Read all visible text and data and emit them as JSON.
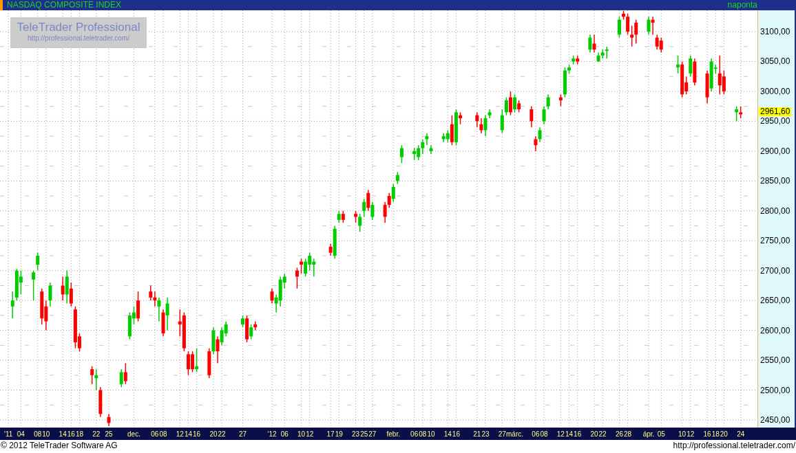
{
  "header": {
    "title": "NASDAQ COMPOSITE INDEX",
    "period": "naponta"
  },
  "logo": {
    "name": "TeleTrader Professional",
    "url": "http://professional.teletrader.com/"
  },
  "chart": {
    "last_price": "2961,60",
    "chart_data": {
      "type": "candlestick",
      "ylim": [
        2437.3,
        3135.7
      ],
      "yticks": [
        {
          "value": 2450,
          "label": "2450,00"
        },
        {
          "value": 2500,
          "label": "2500,00"
        },
        {
          "value": 2550,
          "label": "2550,00"
        },
        {
          "value": 2600,
          "label": "2600,00"
        },
        {
          "value": 2650,
          "label": "2650,00"
        },
        {
          "value": 2700,
          "label": "2700,00"
        },
        {
          "value": 2750,
          "label": "2750,00"
        },
        {
          "value": 2800,
          "label": "2800,00"
        },
        {
          "value": 2850,
          "label": "2850,00"
        },
        {
          "value": 2900,
          "label": "2900,00"
        },
        {
          "value": 2950,
          "label": "2950,00"
        },
        {
          "value": 3000,
          "label": "3000,00"
        },
        {
          "value": 3050,
          "label": "3050,00"
        },
        {
          "value": 3100,
          "label": "3100,00"
        }
      ],
      "grid": true,
      "xlim": [
        "2011-10-30",
        "2012-04-28"
      ],
      "x": [
        "2011-11-02",
        "2011-11-03",
        "2011-11-04",
        "2011-11-07",
        "2011-11-08",
        "2011-11-09",
        "2011-11-10",
        "2011-11-11",
        "2011-11-14",
        "2011-11-15",
        "2011-11-16",
        "2011-11-17",
        "2011-11-18",
        "2011-11-21",
        "2011-11-22",
        "2011-11-23",
        "2011-11-25",
        "2011-11-28",
        "2011-11-29",
        "2011-11-30",
        "2011-12-01",
        "2011-12-02",
        "2011-12-05",
        "2011-12-06",
        "2011-12-07",
        "2011-12-08",
        "2011-12-09",
        "2011-12-12",
        "2011-12-13",
        "2011-12-14",
        "2011-12-15",
        "2011-12-16",
        "2011-12-19",
        "2011-12-20",
        "2011-12-21",
        "2011-12-22",
        "2011-12-23",
        "2011-12-27",
        "2011-12-28",
        "2011-12-29",
        "2011-12-30",
        "2012-01-03",
        "2012-01-04",
        "2012-01-05",
        "2012-01-06",
        "2012-01-09",
        "2012-01-10",
        "2012-01-11",
        "2012-01-12",
        "2012-01-13",
        "2012-01-17",
        "2012-01-18",
        "2012-01-19",
        "2012-01-20",
        "2012-01-23",
        "2012-01-24",
        "2012-01-25",
        "2012-01-26",
        "2012-01-27",
        "2012-01-30",
        "2012-01-31",
        "2012-02-01",
        "2012-02-02",
        "2012-02-03",
        "2012-02-06",
        "2012-02-07",
        "2012-02-08",
        "2012-02-09",
        "2012-02-10",
        "2012-02-13",
        "2012-02-14",
        "2012-02-15",
        "2012-02-16",
        "2012-02-17",
        "2012-02-21",
        "2012-02-22",
        "2012-02-23",
        "2012-02-24",
        "2012-02-27",
        "2012-02-28",
        "2012-02-29",
        "2012-03-01",
        "2012-03-02",
        "2012-03-05",
        "2012-03-06",
        "2012-03-07",
        "2012-03-08",
        "2012-03-09",
        "2012-03-12",
        "2012-03-13",
        "2012-03-14",
        "2012-03-15",
        "2012-03-16",
        "2012-03-19",
        "2012-03-20",
        "2012-03-21",
        "2012-03-22",
        "2012-03-23",
        "2012-03-26",
        "2012-03-27",
        "2012-03-28",
        "2012-03-29",
        "2012-03-30",
        "2012-04-02",
        "2012-04-03",
        "2012-04-04",
        "2012-04-05",
        "2012-04-09",
        "2012-04-10",
        "2012-04-11",
        "2012-04-12",
        "2012-04-13",
        "2012-04-16",
        "2012-04-17",
        "2012-04-18",
        "2012-04-19",
        "2012-04-20",
        "2012-04-23",
        "2012-04-24"
      ],
      "xticks": [
        {
          "value": "2011-11-01",
          "label": "'11"
        },
        {
          "value": "2011-11-04",
          "label": "04"
        },
        {
          "value": "2011-11-08",
          "label": "08"
        },
        {
          "value": "2011-11-10",
          "label": "10"
        },
        {
          "value": "2011-11-14",
          "label": "14"
        },
        {
          "value": "2011-11-16",
          "label": "16"
        },
        {
          "value": "2011-11-18",
          "label": "18"
        },
        {
          "value": "2011-11-22",
          "label": "22"
        },
        {
          "value": "2011-11-25",
          "label": "25"
        },
        {
          "value": "2011-12-01",
          "label": "dec."
        },
        {
          "value": "2011-12-06",
          "label": "06"
        },
        {
          "value": "2011-12-08",
          "label": "08"
        },
        {
          "value": "2011-12-12",
          "label": "12"
        },
        {
          "value": "2011-12-14",
          "label": "14"
        },
        {
          "value": "2011-12-16",
          "label": "16"
        },
        {
          "value": "2011-12-20",
          "label": "20"
        },
        {
          "value": "2011-12-22",
          "label": "22"
        },
        {
          "value": "2011-12-27",
          "label": "27"
        },
        {
          "value": "2012-01-03",
          "label": "'12"
        },
        {
          "value": "2012-01-06",
          "label": "06"
        },
        {
          "value": "2012-01-10",
          "label": "10"
        },
        {
          "value": "2012-01-12",
          "label": "12"
        },
        {
          "value": "2012-01-17",
          "label": "17"
        },
        {
          "value": "2012-01-19",
          "label": "19"
        },
        {
          "value": "2012-01-23",
          "label": "23"
        },
        {
          "value": "2012-01-25",
          "label": "25"
        },
        {
          "value": "2012-01-27",
          "label": "27"
        },
        {
          "value": "2012-02-01",
          "label": "febr."
        },
        {
          "value": "2012-02-06",
          "label": "06"
        },
        {
          "value": "2012-02-08",
          "label": "08"
        },
        {
          "value": "2012-02-10",
          "label": "10"
        },
        {
          "value": "2012-02-14",
          "label": "14"
        },
        {
          "value": "2012-02-16",
          "label": "16"
        },
        {
          "value": "2012-02-21",
          "label": "21"
        },
        {
          "value": "2012-02-23",
          "label": "23"
        },
        {
          "value": "2012-02-27",
          "label": "27"
        },
        {
          "value": "2012-03-01",
          "label": "márc."
        },
        {
          "value": "2012-03-06",
          "label": "06"
        },
        {
          "value": "2012-03-08",
          "label": "08"
        },
        {
          "value": "2012-03-12",
          "label": "12"
        },
        {
          "value": "2012-03-14",
          "label": "14"
        },
        {
          "value": "2012-03-16",
          "label": "16"
        },
        {
          "value": "2012-03-20",
          "label": "20"
        },
        {
          "value": "2012-03-22",
          "label": "22"
        },
        {
          "value": "2012-03-26",
          "label": "26"
        },
        {
          "value": "2012-03-28",
          "label": "28"
        },
        {
          "value": "2012-04-02",
          "label": "ápr."
        },
        {
          "value": "2012-04-05",
          "label": "05"
        },
        {
          "value": "2012-04-10",
          "label": "10"
        },
        {
          "value": "2012-04-12",
          "label": "12"
        },
        {
          "value": "2012-04-16",
          "label": "16"
        },
        {
          "value": "2012-04-18",
          "label": "18"
        },
        {
          "value": "2012-04-20",
          "label": "20"
        },
        {
          "value": "2012-04-24",
          "label": "24"
        }
      ],
      "ohlc": [
        [
          2640,
          2665,
          2620,
          2650
        ],
        [
          2655,
          2703,
          2650,
          2700
        ],
        [
          2680,
          2700,
          2660,
          2690
        ],
        [
          2685,
          2700,
          2650,
          2697
        ],
        [
          2710,
          2730,
          2700,
          2725
        ],
        [
          2665,
          2670,
          2610,
          2620
        ],
        [
          2640,
          2650,
          2600,
          2615
        ],
        [
          2650,
          2680,
          2640,
          2675
        ],
        [
          2675,
          2690,
          2650,
          2660
        ],
        [
          2660,
          2700,
          2645,
          2690
        ],
        [
          2670,
          2680,
          2640,
          2645
        ],
        [
          2635,
          2640,
          2570,
          2580
        ],
        [
          2590,
          2595,
          2565,
          2570
        ],
        [
          2535,
          2540,
          2510,
          2525
        ],
        [
          2520,
          2535,
          2500,
          2525
        ],
        [
          2500,
          2505,
          2455,
          2460
        ],
        [
          2455,
          2460,
          2440,
          2445
        ],
        [
          2510,
          2535,
          2505,
          2530
        ],
        [
          2530,
          2545,
          2510,
          2515
        ],
        [
          2590,
          2630,
          2585,
          2625
        ],
        [
          2620,
          2640,
          2610,
          2630
        ],
        [
          2650,
          2665,
          2615,
          2620
        ],
        [
          2665,
          2675,
          2650,
          2655
        ],
        [
          2655,
          2665,
          2640,
          2650
        ],
        [
          2640,
          2655,
          2615,
          2650
        ],
        [
          2630,
          2635,
          2590,
          2595
        ],
        [
          2625,
          2655,
          2600,
          2645
        ],
        [
          2615,
          2635,
          2590,
          2610
        ],
        [
          2625,
          2630,
          2565,
          2570
        ],
        [
          2560,
          2565,
          2525,
          2535
        ],
        [
          2560,
          2565,
          2530,
          2535
        ],
        [
          2535,
          2570,
          2530,
          2540
        ],
        [
          2565,
          2570,
          2520,
          2525
        ],
        [
          2565,
          2605,
          2560,
          2600
        ],
        [
          2585,
          2590,
          2545,
          2565
        ],
        [
          2580,
          2605,
          2575,
          2600
        ],
        [
          2595,
          2615,
          2590,
          2610
        ],
        [
          2610,
          2625,
          2605,
          2620
        ],
        [
          2620,
          2625,
          2580,
          2585
        ],
        [
          2590,
          2610,
          2585,
          2605
        ],
        [
          2610,
          2615,
          2600,
          2605
        ],
        [
          2665,
          2670,
          2645,
          2650
        ],
        [
          2645,
          2660,
          2630,
          2655
        ],
        [
          2650,
          2690,
          2640,
          2685
        ],
        [
          2680,
          2695,
          2670,
          2690
        ],
        [
          2700,
          2705,
          2670,
          2690
        ],
        [
          2715,
          2720,
          2695,
          2710
        ],
        [
          2695,
          2720,
          2690,
          2715
        ],
        [
          2710,
          2730,
          2700,
          2725
        ],
        [
          2710,
          2720,
          2690,
          2715
        ],
        [
          2740,
          2745,
          2725,
          2730
        ],
        [
          2725,
          2775,
          2720,
          2770
        ],
        [
          2785,
          2800,
          2780,
          2795
        ],
        [
          2795,
          2800,
          2780,
          2785
        ],
        [
          2795,
          2800,
          2780,
          2790
        ],
        [
          2775,
          2795,
          2765,
          2790
        ],
        [
          2800,
          2820,
          2790,
          2815
        ],
        [
          2830,
          2835,
          2800,
          2805
        ],
        [
          2790,
          2815,
          2785,
          2810
        ],
        [
          2810,
          2815,
          2780,
          2790
        ],
        [
          2825,
          2830,
          2805,
          2810
        ],
        [
          2820,
          2845,
          2815,
          2840
        ],
        [
          2850,
          2865,
          2845,
          2860
        ],
        [
          2890,
          2910,
          2880,
          2905
        ],
        [
          2895,
          2905,
          2885,
          2900
        ],
        [
          2890,
          2910,
          2885,
          2905
        ],
        [
          2905,
          2920,
          2895,
          2915
        ],
        [
          2920,
          2930,
          2910,
          2925
        ],
        [
          2900,
          2910,
          2895,
          2905
        ],
        [
          2920,
          2930,
          2915,
          2925
        ],
        [
          2920,
          2935,
          2915,
          2930
        ],
        [
          2945,
          2960,
          2910,
          2915
        ],
        [
          2915,
          2970,
          2910,
          2965
        ],
        [
          2960,
          2965,
          2945,
          2955
        ],
        [
          2960,
          2965,
          2940,
          2950
        ],
        [
          2945,
          2955,
          2930,
          2935
        ],
        [
          2935,
          2960,
          2925,
          2955
        ],
        [
          2960,
          2970,
          2955,
          2965
        ],
        [
          2935,
          2970,
          2930,
          2960
        ],
        [
          2965,
          2990,
          2960,
          2985
        ],
        [
          2990,
          3000,
          2960,
          2965
        ],
        [
          2970,
          2995,
          2965,
          2990
        ],
        [
          2980,
          2985,
          2965,
          2970
        ],
        [
          2970,
          2975,
          2940,
          2950
        ],
        [
          2920,
          2925,
          2900,
          2910
        ],
        [
          2920,
          2940,
          2915,
          2935
        ],
        [
          2950,
          2975,
          2945,
          2970
        ],
        [
          2975,
          2995,
          2970,
          2990
        ],
        [
          2990,
          2995,
          2975,
          2985
        ],
        [
          2995,
          3040,
          2990,
          3035
        ],
        [
          3035,
          3045,
          3030,
          3040
        ],
        [
          3050,
          3060,
          3045,
          3055
        ],
        [
          3055,
          3060,
          3045,
          3050
        ],
        [
          3070,
          3095,
          3065,
          3090
        ],
        [
          3080,
          3095,
          3065,
          3070
        ],
        [
          3050,
          3065,
          3050,
          3060
        ],
        [
          3060,
          3070,
          3055,
          3065
        ],
        [
          3070,
          3075,
          3055,
          3070
        ],
        [
          3095,
          3125,
          3090,
          3120
        ],
        [
          3130,
          3135,
          3120,
          3125
        ],
        [
          3125,
          3130,
          3095,
          3100
        ],
        [
          3095,
          3110,
          3075,
          3090
        ],
        [
          3115,
          3120,
          3080,
          3095
        ],
        [
          3100,
          3125,
          3095,
          3120
        ],
        [
          3120,
          3125,
          3095,
          3115
        ],
        [
          3090,
          3095,
          3070,
          3075
        ],
        [
          3085,
          3090,
          3065,
          3070
        ],
        [
          3040,
          3060,
          3030,
          3045
        ],
        [
          3045,
          3050,
          2990,
          2995
        ],
        [
          3015,
          3025,
          2995,
          3000
        ],
        [
          3030,
          3060,
          3025,
          3055
        ],
        [
          3050,
          3055,
          3010,
          3015
        ],
        [
          3030,
          3035,
          2980,
          2990
        ],
        [
          3005,
          3055,
          3000,
          3050
        ],
        [
          3040,
          3045,
          3030,
          3040
        ],
        [
          3030,
          3060,
          2995,
          3010
        ],
        [
          3025,
          3035,
          2995,
          3000
        ],
        [
          2965,
          2975,
          2950,
          2970
        ],
        [
          2965,
          2975,
          2955,
          2961.6
        ]
      ]
    }
  },
  "footer": {
    "copyright": "© 2012 TeleTrader Software AG",
    "url": "http://professional.teletrader.com/"
  }
}
